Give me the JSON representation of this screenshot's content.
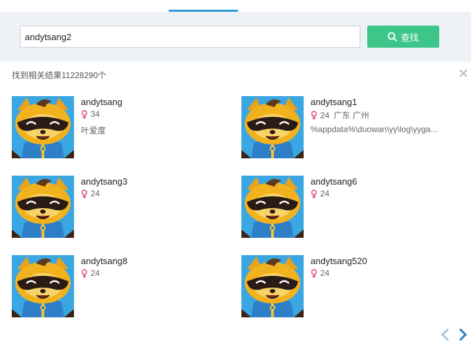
{
  "search": {
    "query": "andytsang2",
    "button_label": "查找"
  },
  "results": {
    "count_text": "找到相关结果11228290个",
    "users": [
      {
        "name": "andytsang",
        "age": "34",
        "location": "",
        "signature": "叶爱度"
      },
      {
        "name": "andytsang1",
        "age": "24",
        "location": "广东 广州",
        "signature": "%appdata%\\duowan\\yy\\log\\yyga..."
      },
      {
        "name": "andytsang3",
        "age": "24",
        "location": "",
        "signature": ""
      },
      {
        "name": "andytsang6",
        "age": "24",
        "location": "",
        "signature": ""
      },
      {
        "name": "andytsang8",
        "age": "24",
        "location": "",
        "signature": ""
      },
      {
        "name": "andytsang520",
        "age": "24",
        "location": "",
        "signature": ""
      }
    ]
  },
  "colors": {
    "accent_blue": "#2b9bd6",
    "search_green": "#3cc68a",
    "female_pink": "#e0508a",
    "band_bg": "#eef2f7"
  },
  "icons": [
    "search-icon",
    "close-icon",
    "female-icon",
    "chevron-left-icon",
    "chevron-right-icon"
  ]
}
